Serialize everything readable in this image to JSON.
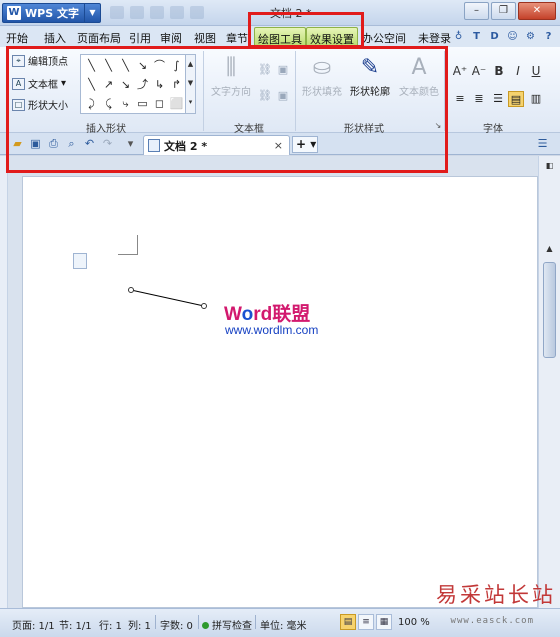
{
  "titlebar": {
    "app_logo": "W",
    "app_label": "WPS 文字",
    "window_title": "文档 2 *",
    "minimize": "–",
    "restore": "❐",
    "close": "✕"
  },
  "menubar": {
    "items": [
      "开始",
      "插入",
      "页面布局",
      "引用",
      "审阅",
      "视图",
      "章节"
    ],
    "context_tabs": [
      "绘图工具",
      "效果设置"
    ],
    "extra_item": "办公空间",
    "login": "未登录",
    "right_icons": [
      "T",
      "D",
      "?"
    ]
  },
  "ribbon": {
    "groups": {
      "insert_shape": {
        "label": "插入形状",
        "commands": [
          "编辑顶点",
          "文本框",
          "形状大小"
        ],
        "gallery_shapes": [
          "╲",
          "╲",
          "╲",
          "↘",
          "⌒",
          "∫",
          "╲",
          "↗",
          "↘",
          "⤴",
          "↳",
          "↱",
          "⤸",
          "⤹",
          "⤷",
          "▭",
          "◻",
          "⬜"
        ]
      },
      "textbox": {
        "label": "文本框",
        "text_direction": "文字方向"
      },
      "shape_style": {
        "label": "形状样式",
        "fill": "形状填充",
        "outline": "形状轮廓",
        "text_color": "文本颜色"
      },
      "font": {
        "label": "字体",
        "buttons": [
          "A⁺",
          "A⁻",
          "B",
          "I",
          "U"
        ],
        "align": [
          "≡",
          "≣",
          "☰",
          "▤",
          "▥"
        ]
      }
    }
  },
  "tabbar": {
    "doc_tab": "文档 2 *",
    "close_x": "×",
    "new_tab": "+ ▾"
  },
  "document": {
    "watermark_prefix": "W",
    "watermark_o": "o",
    "watermark_rest": "rd联盟",
    "watermark_url": "www.wordlm.com"
  },
  "statusbar": {
    "page": "页面: 1/1",
    "section": "节: 1/1",
    "row": "行: 1",
    "col": "列: 1",
    "word_count": "字数: 0",
    "spell_check": "拼写检查",
    "unit": "单位: 毫米",
    "zoom": "100 %"
  },
  "overlay": {
    "site_stamp": "易采站长站",
    "site_url": "www.easck.com"
  },
  "colors": {
    "highlight_red": "#e11b1b",
    "context_tab_green": "#b7db6b",
    "watermark_pink": "#d2196e",
    "watermark_blue": "#1540c2"
  }
}
